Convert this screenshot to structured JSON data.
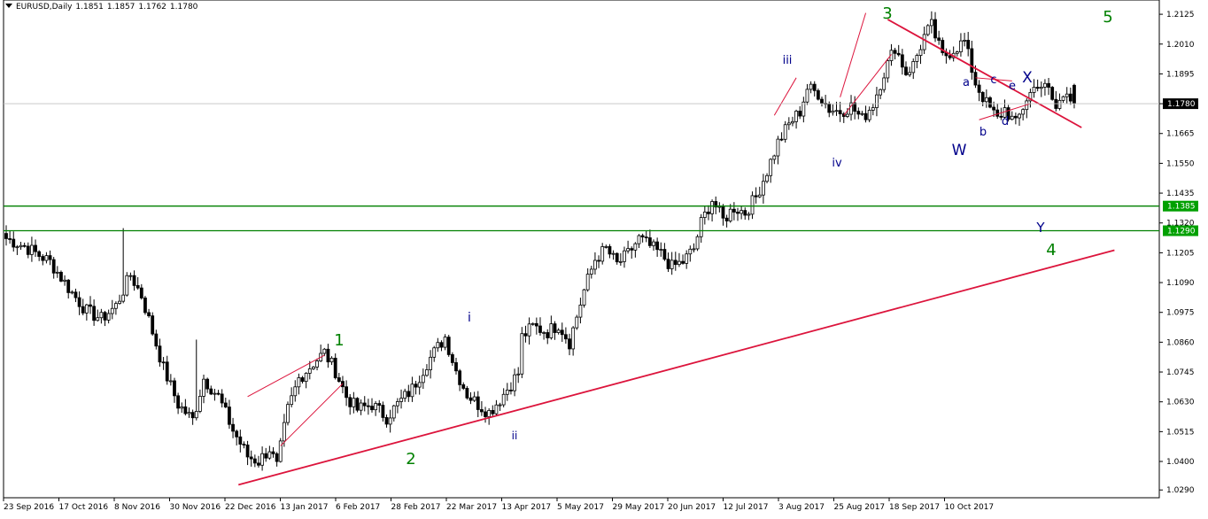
{
  "symbol": "EURUSD,Daily",
  "ohlc": {
    "open": "1.1851",
    "high": "1.1857",
    "low": "1.1762",
    "close": "1.1780"
  },
  "colors": {
    "candle": "#000000",
    "trendline": "#dc143c",
    "green": "#008000",
    "navy": "#00008b",
    "price_label_bg": "#000000",
    "green_label_bg": "#00a000"
  },
  "chart_data": {
    "type": "candlestick",
    "title": "EURUSD,Daily",
    "ylim": [
      1.026,
      1.218
    ],
    "y_ticks": [
      "1.2125",
      "1.2010",
      "1.1895",
      "1.1780",
      "1.1665",
      "1.1550",
      "1.1435",
      "1.1320",
      "1.1205",
      "1.1090",
      "1.0975",
      "1.0860",
      "1.0745",
      "1.0630",
      "1.0515",
      "1.0400",
      "1.0290"
    ],
    "x_labels": [
      "23 Sep 2016",
      "17 Oct 2016",
      "8 Nov 2016",
      "30 Nov 2016",
      "22 Dec 2016",
      "13 Jan 2017",
      "6 Feb 2017",
      "28 Feb 2017",
      "22 Mar 2017",
      "13 Apr 2017",
      "5 May 2017",
      "29 May 2017",
      "20 Jun 2017",
      "12 Jul 2017",
      "3 Aug 2017",
      "25 Aug 2017",
      "18 Sep 2017",
      "10 Oct 2017"
    ],
    "key_points": [
      [
        0,
        1.126
      ],
      [
        5,
        1.123
      ],
      [
        12,
        1.117
      ],
      [
        18,
        1.105
      ],
      [
        22,
        1.098
      ],
      [
        26,
        1.095
      ],
      [
        30,
        1.1
      ],
      [
        34,
        1.112
      ],
      [
        37,
        1.104
      ],
      [
        40,
        1.09
      ],
      [
        43,
        1.076
      ],
      [
        47,
        1.062
      ],
      [
        51,
        1.056
      ],
      [
        54,
        1.072
      ],
      [
        58,
        1.065
      ],
      [
        62,
        1.052
      ],
      [
        66,
        1.042
      ],
      [
        69,
        1.04
      ],
      [
        72,
        1.045
      ],
      [
        74,
        1.038
      ],
      [
        77,
        1.06
      ],
      [
        80,
        1.072
      ],
      [
        84,
        1.078
      ],
      [
        87,
        1.082
      ],
      [
        90,
        1.075
      ],
      [
        93,
        1.065
      ],
      [
        96,
        1.06
      ],
      [
        100,
        1.062
      ],
      [
        104,
        1.057
      ],
      [
        107,
        1.062
      ],
      [
        111,
        1.068
      ],
      [
        115,
        1.078
      ],
      [
        118,
        1.084
      ],
      [
        120,
        1.088
      ],
      [
        123,
        1.075
      ],
      [
        126,
        1.066
      ],
      [
        129,
        1.062
      ],
      [
        132,
        1.059
      ],
      [
        135,
        1.064
      ],
      [
        138,
        1.07
      ],
      [
        140,
        1.074
      ],
      [
        141,
        1.088
      ],
      [
        144,
        1.092
      ],
      [
        148,
        1.09
      ],
      [
        151,
        1.093
      ],
      [
        154,
        1.086
      ],
      [
        158,
        1.106
      ],
      [
        161,
        1.118
      ],
      [
        164,
        1.122
      ],
      [
        167,
        1.116
      ],
      [
        170,
        1.12
      ],
      [
        173,
        1.126
      ],
      [
        176,
        1.123
      ],
      [
        179,
        1.12
      ],
      [
        182,
        1.115
      ],
      [
        185,
        1.117
      ],
      [
        188,
        1.122
      ],
      [
        190,
        1.132
      ],
      [
        193,
        1.141
      ],
      [
        196,
        1.133
      ],
      [
        199,
        1.138
      ],
      [
        202,
        1.136
      ],
      [
        205,
        1.142
      ],
      [
        208,
        1.152
      ],
      [
        211,
        1.163
      ],
      [
        214,
        1.17
      ],
      [
        217,
        1.175
      ],
      [
        219,
        1.184
      ],
      [
        222,
        1.182
      ],
      [
        225,
        1.176
      ],
      [
        228,
        1.175
      ],
      [
        231,
        1.177
      ],
      [
        234,
        1.172
      ],
      [
        237,
        1.178
      ],
      [
        240,
        1.19
      ],
      [
        243,
        1.2
      ],
      [
        246,
        1.19
      ],
      [
        248,
        1.193
      ],
      [
        251,
        1.204
      ],
      [
        253,
        1.208
      ],
      [
        256,
        1.196
      ],
      [
        259,
        1.199
      ],
      [
        262,
        1.202
      ],
      [
        265,
        1.186
      ],
      [
        268,
        1.178
      ],
      [
        271,
        1.172
      ],
      [
        273,
        1.176
      ],
      [
        276,
        1.17
      ],
      [
        279,
        1.18
      ],
      [
        282,
        1.186
      ],
      [
        285,
        1.183
      ],
      [
        287,
        1.176
      ],
      [
        290,
        1.184
      ],
      [
        292,
        1.178
      ]
    ],
    "last_price": "1.1780",
    "horizontal_lines": [
      {
        "price": 1.1385,
        "label": "1.1385"
      },
      {
        "price": 1.129,
        "label": "1.1290"
      }
    ],
    "wave_labels": {
      "green": [
        "1",
        "2",
        "3",
        "4",
        "5"
      ],
      "navy": [
        "i",
        "ii",
        "iii",
        "iv",
        "a",
        "b",
        "c",
        "d",
        "e",
        "W",
        "X",
        "Y"
      ]
    }
  }
}
